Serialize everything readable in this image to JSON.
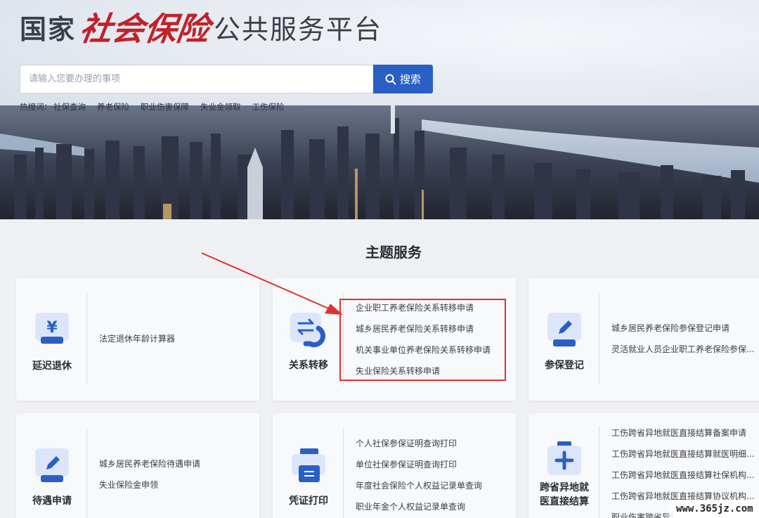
{
  "header": {
    "logo_part1": "国家",
    "logo_part2": "社会保险",
    "logo_part3": "公共服务平台"
  },
  "search": {
    "placeholder": "请输入您要办理的事项",
    "button_label": "搜索"
  },
  "hot_words": {
    "label": "热搜词：",
    "items": [
      "社保查询",
      "养老保险",
      "职业伤害保障",
      "失业金领取",
      "工伤保险"
    ]
  },
  "section_title": "主题服务",
  "cards": [
    {
      "name": "延迟退休",
      "icon": "yuan-icon",
      "items": [
        "法定退休年龄计算器"
      ]
    },
    {
      "name": "关系转移",
      "icon": "transfer-icon",
      "items": [
        "企业职工养老保险关系转移申请",
        "城乡居民养老保险关系转移申请",
        "机关事业单位养老保险关系转移申请",
        "失业保险关系转移申请"
      ]
    },
    {
      "name": "参保登记",
      "icon": "pen-icon",
      "items": [
        "城乡居民养老保险参保登记申请",
        "灵活就业人员企业职工养老保险参保..."
      ]
    },
    {
      "name": "待遇申请",
      "icon": "pen-icon",
      "items": [
        "城乡居民养老保险待遇申请",
        "失业保险金申领"
      ]
    },
    {
      "name": "凭证打印",
      "icon": "printer-icon",
      "items": [
        "个人社保参保证明查询打印",
        "单位社保参保证明查询打印",
        "年度社会保险个人权益记录单查询",
        "职业年金个人权益记录单查询"
      ]
    },
    {
      "name1": "跨省异地就",
      "name2": "医直接结算",
      "icon": "medical-plus-icon",
      "items": [
        "工伤跨省异地就医直接结算备案申请",
        "工伤跨省异地就医直接结算就医明细...",
        "工伤跨省异地就医直接结算社保机构...",
        "工伤跨省异地就医直接结算协议机构...",
        "职业伤害跨省异地就医直接结算备案..."
      ]
    }
  ],
  "watermark": "www.365jz.com",
  "colors": {
    "brand_blue": "#2a5fc4",
    "logo_red": "#c0222a",
    "highlight_red": "#e0312f"
  }
}
